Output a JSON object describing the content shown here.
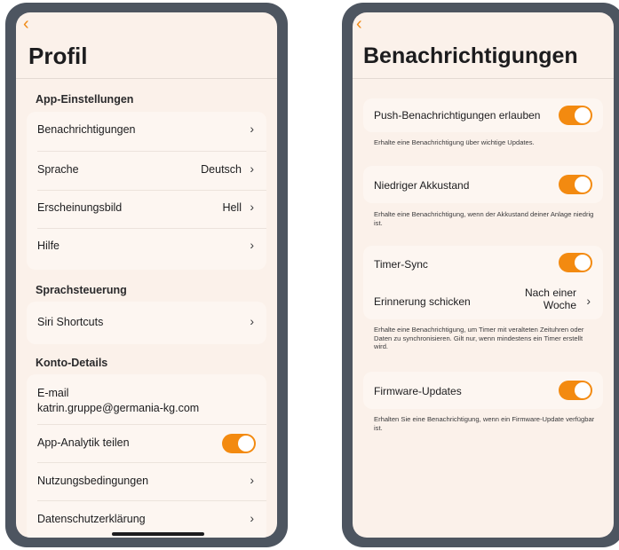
{
  "profil": {
    "back_icon": "chevron-left-icon",
    "title": "Profil",
    "sections": {
      "app": "App-Einstellungen",
      "siri": "Sprachsteuerung",
      "konto": "Konto-Details"
    },
    "app_items": [
      {
        "label": "Benachrichtigungen",
        "value": ""
      },
      {
        "label": "Sprache",
        "value": "Deutsch"
      },
      {
        "label": "Erscheinungsbild",
        "value": "Hell"
      },
      {
        "label": "Hilfe",
        "value": ""
      }
    ],
    "siri_item": "Siri Shortcuts",
    "email_label": "E-mail",
    "email_value": "katrin.gruppe@germania-kg.com",
    "analytics_label": "App-Analytik teilen",
    "analytics_on": true,
    "terms_label": "Nutzungsbedingungen",
    "privacy_label": "Datenschutzerklärung"
  },
  "benachrichtigungen": {
    "title": "Benachrichtigungen",
    "push_label": "Push-Benachrichtigungen erlauben",
    "push_desc": "Erhalte eine Benachrichtigung über wichtige Updates.",
    "battery_label": "Niedriger Akkustand",
    "battery_desc": "Erhalte eine Benachrichtigung, wenn der Akkustand deiner Anlage niedrig ist.",
    "timer_label": "Timer-Sync",
    "reminder_label": "Erinnerung schicken",
    "reminder_value": "Nach einer Woche",
    "timer_desc": "Erhalte eine Benachrichtigung, um Timer mit veralteten Zeituhren oder Daten zu synchronisieren. Gilt nur, wenn mindestens ein Timer erstellt wird.",
    "firmware_label": "Firmware-Updates",
    "firmware_desc": "Erhalten Sie eine Benachrichtigung, wenn ein Firmware-Update verfügbar ist."
  },
  "colors": {
    "accent": "#f38a10",
    "background": "#fbf1ea",
    "frame": "#4d5560"
  }
}
